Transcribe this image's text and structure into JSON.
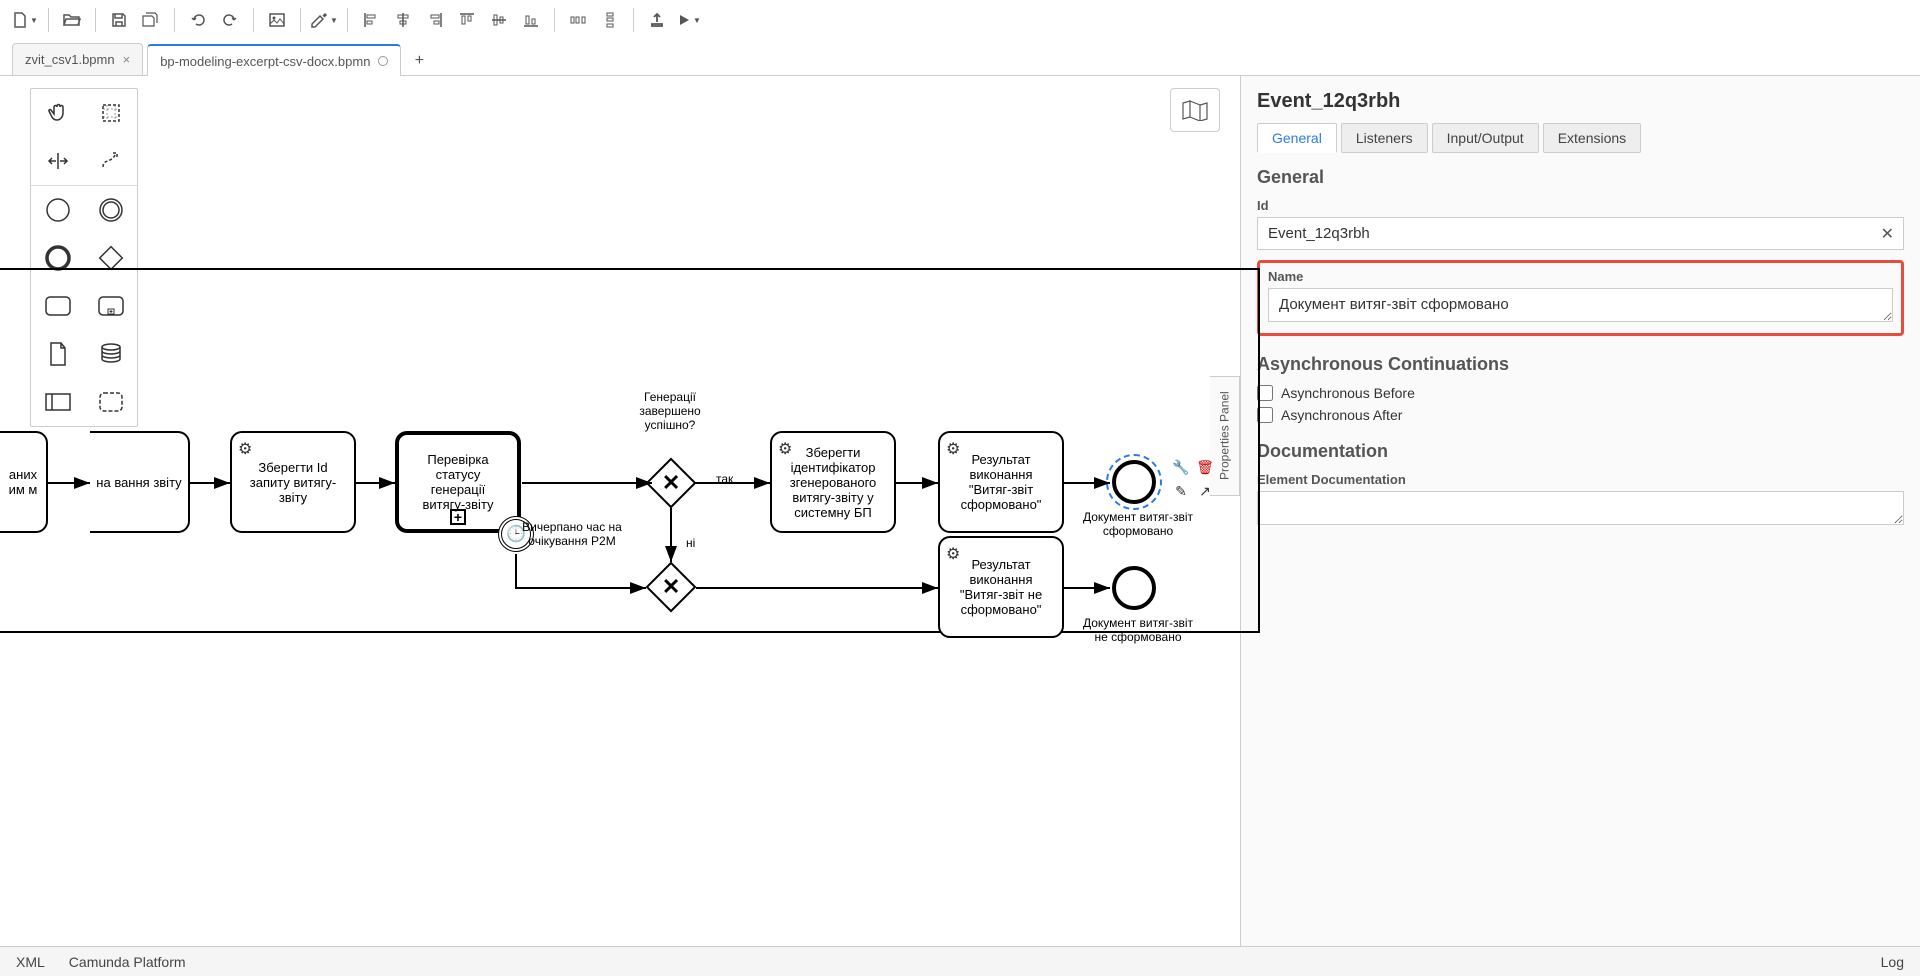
{
  "toolbar": {
    "new": "New",
    "open": "Open",
    "save": "Save",
    "save_all": "Save All",
    "undo": "Undo",
    "redo": "Redo",
    "image": "Export Image",
    "paint": "Color",
    "align_left": "Align Left",
    "align_center": "Align Center",
    "align_right": "Align Right",
    "align_top": "Align Top",
    "align_middle": "Align Middle",
    "align_bottom": "Align Bottom",
    "dist_h": "Distribute H",
    "dist_v": "Distribute V",
    "deploy": "Deploy",
    "run": "Start"
  },
  "tabs": [
    {
      "label": "zvit_csv1.bpmn",
      "active": false,
      "dirty": false
    },
    {
      "label": "bp-modeling-excerpt-csv-docx.bpmn",
      "active": true,
      "dirty": true
    }
  ],
  "palette": {
    "hand": "Hand Tool",
    "lasso": "Lasso Tool",
    "space": "Space Tool",
    "connect": "Global Connect",
    "start": "Start Event",
    "intermediate": "Intermediate Event",
    "end": "End Event",
    "gateway": "Gateway",
    "task": "Task",
    "subprocess": "Subprocess",
    "data_object": "Data Object",
    "data_store": "Data Store",
    "participant": "Participant",
    "group": "Group"
  },
  "diagram": {
    "task_partial_1": "аних\nим\nм",
    "task_partial_2": "на\nвання\nзвіту",
    "task_save_id": "Зберегти Id запиту витягу-звіту",
    "task_check_status": "Перевірка статусу генерації витягу-звіту",
    "gateway_label": "Генерації завершено успішно?",
    "flow_yes": "так",
    "flow_no": "ні",
    "timer_label": "Вичерпано час на очікування P2M",
    "task_save_gen_id": "Зберегти ідентифікатор згенерованого витягу-звіту у системну БП",
    "task_result_ok": "Результат виконання \"Витяг-звіт сформовано\"",
    "task_result_fail": "Результат виконання \"Витяг-звіт не сформовано\"",
    "end_ok_label": "Документ витяг-звіт сформовано",
    "end_fail_label": "Документ витяг-звіт не сформовано"
  },
  "props": {
    "element_id": "Event_12q3rbh",
    "tabs": [
      "General",
      "Listeners",
      "Input/Output",
      "Extensions"
    ],
    "active_tab": 0,
    "section_general": "General",
    "label_id": "Id",
    "value_id": "Event_12q3rbh",
    "label_name": "Name",
    "value_name": "Документ витяг-звіт сформовано",
    "section_async": "Asynchronous Continuations",
    "async_before": "Asynchronous Before",
    "async_after": "Asynchronous After",
    "section_doc": "Documentation",
    "label_doc": "Element Documentation",
    "value_doc": ""
  },
  "props_tab_label": "Properties Panel",
  "footer": {
    "xml": "XML",
    "platform": "Camunda Platform",
    "log": "Log"
  }
}
